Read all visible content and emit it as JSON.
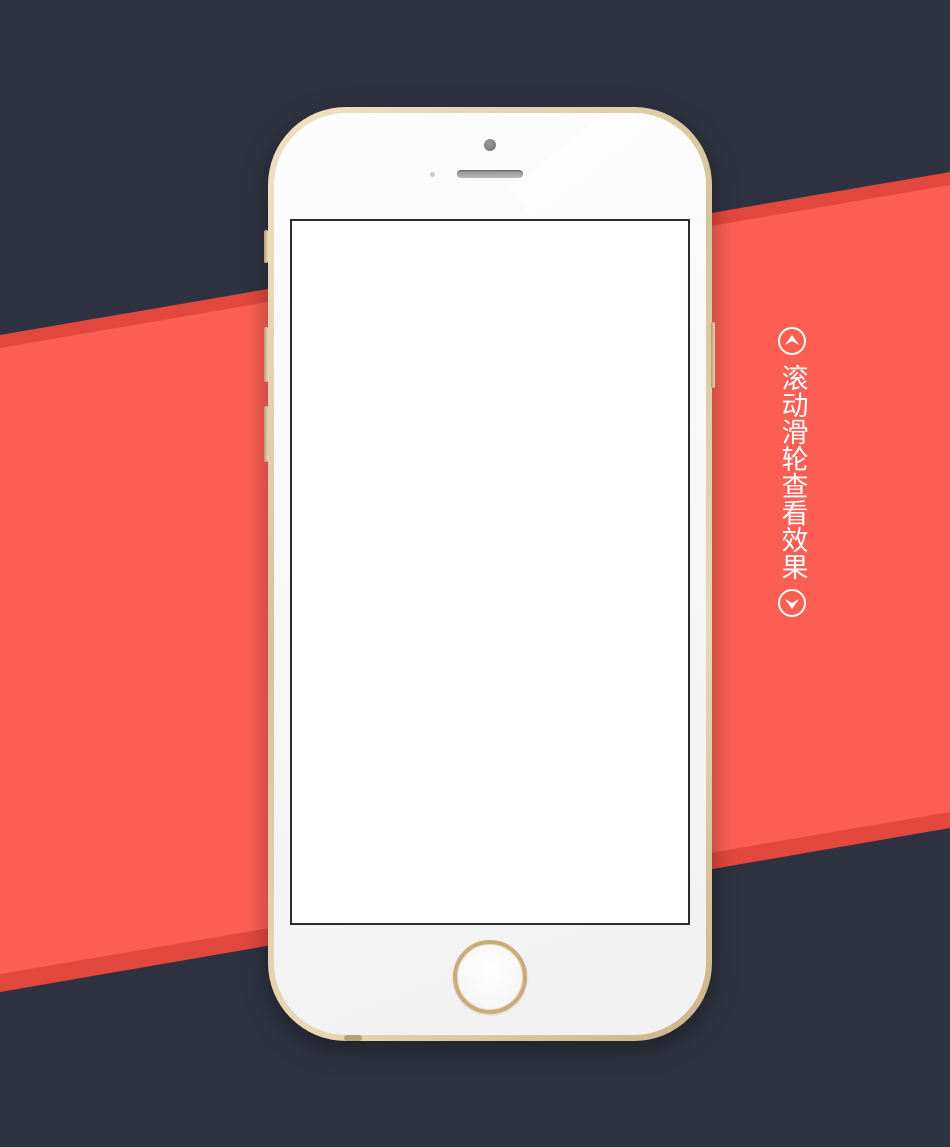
{
  "background": {
    "base_color": "#2f3240",
    "band_color": "#fd5e54",
    "band_edge_color": "#e3483f"
  },
  "device": {
    "body_color": "#d9c7a0",
    "face_color": "#f6f6f6",
    "screen_color": "#ffffff"
  },
  "scroll_hint": {
    "text": "滚动滑轮查看效果",
    "up_icon": "chevron-up-circle-icon",
    "down_icon": "chevron-down-circle-icon",
    "color": "#ffffff"
  }
}
